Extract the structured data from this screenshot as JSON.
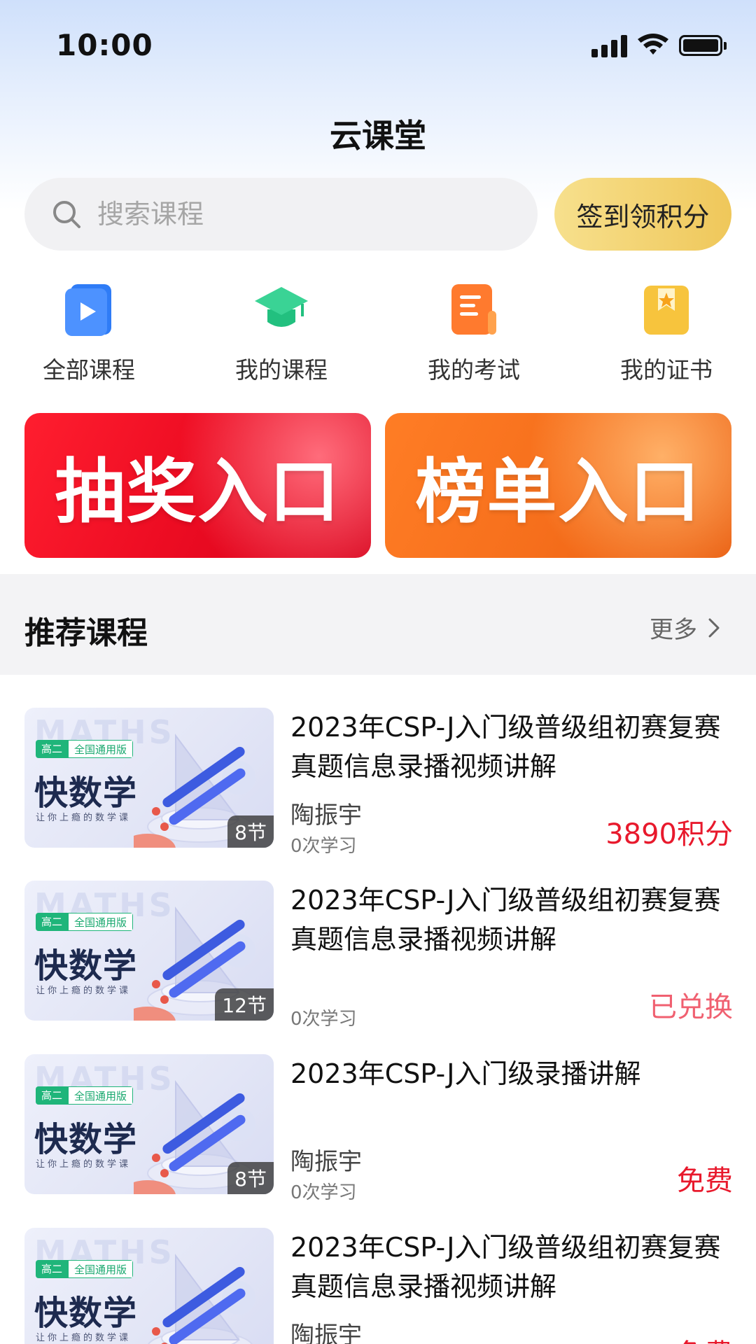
{
  "status_bar": {
    "time": "10:00"
  },
  "header": {
    "title": "云课堂"
  },
  "search": {
    "placeholder": "搜索课程"
  },
  "checkin": {
    "label": "签到领积分"
  },
  "quick_entries": [
    {
      "label": "全部课程",
      "icon": "play-book-icon",
      "color": "#2f7cf6"
    },
    {
      "label": "我的课程",
      "icon": "graduation-cap-icon",
      "color": "#22c07f"
    },
    {
      "label": "我的考试",
      "icon": "exam-paper-icon",
      "color": "#ff7a2e"
    },
    {
      "label": "我的证书",
      "icon": "certificate-star-icon",
      "color": "#f7c43d"
    }
  ],
  "banners": [
    {
      "label": "抽奖入口"
    },
    {
      "label": "榜单入口"
    }
  ],
  "section": {
    "title": "推荐课程",
    "more": "更多"
  },
  "course_thumb": {
    "watermark": "MATHS",
    "tag_grade": "高二",
    "tag_edition": "全国通用版",
    "brand": "快数学",
    "slogan": "让你上瘾的数学课"
  },
  "courses": [
    {
      "title": "2023年CSP-J入门级普级组初赛复赛真题信息录播视频讲解",
      "teacher": "陶振宇",
      "views": "0次学习",
      "lessons": "8节",
      "price": "3890积分"
    },
    {
      "title": "2023年CSP-J入门级普级组初赛复赛真题信息录播视频讲解",
      "teacher": "",
      "views": "0次学习",
      "lessons": "12节",
      "price": "已兑换"
    },
    {
      "title": "2023年CSP-J入门级录播讲解",
      "teacher": "陶振宇",
      "views": "0次学习",
      "lessons": "8节",
      "price": "免费"
    },
    {
      "title": "2023年CSP-J入门级普级组初赛复赛真题信息录播视频讲解",
      "teacher": "陶振宇",
      "views": "",
      "lessons": "",
      "price": "免费"
    }
  ]
}
